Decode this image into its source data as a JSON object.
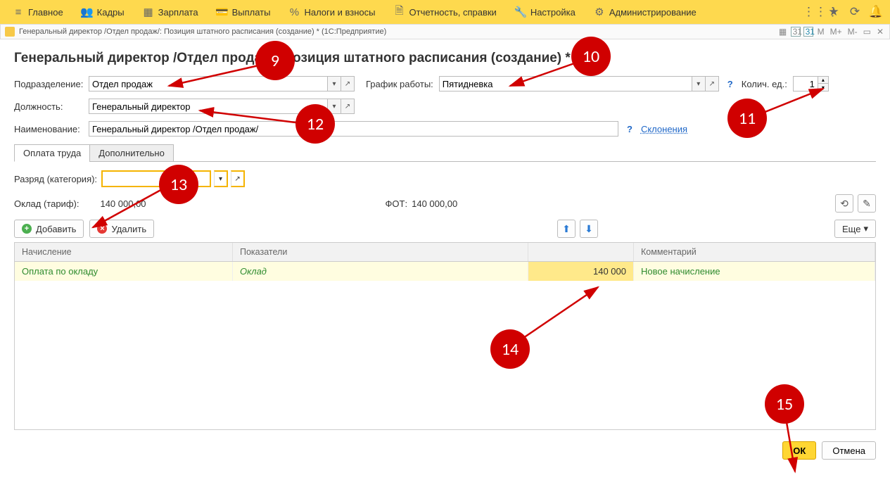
{
  "nav": {
    "items": [
      {
        "icon": "≡",
        "label": "Главное"
      },
      {
        "icon": "👥",
        "label": "Кадры"
      },
      {
        "icon": "▦",
        "label": "Зарплата"
      },
      {
        "icon": "💳",
        "label": "Выплаты"
      },
      {
        "icon": "%",
        "label": "Налоги и взносы"
      },
      {
        "icon": "🗎",
        "label": "Отчетность, справки"
      },
      {
        "icon": "🔧",
        "label": "Настройка"
      },
      {
        "icon": "⚙",
        "label": "Администрирование"
      }
    ],
    "right_glyphs": [
      "⋮⋮⋮",
      "★",
      "⟳",
      "🔔"
    ]
  },
  "windowbar": {
    "title": "Генеральный директор /Отдел продаж/: Позиция штатного расписания (создание) *  (1С:Предприятие)",
    "cal_text": "31",
    "m": "M",
    "mplus": "M+",
    "mminus": "M-",
    "dash": "▭",
    "close": "✕"
  },
  "page": {
    "title": "Генеральный директор /Отдел продаж/: Позиция штатного расписания (создание) *"
  },
  "labels": {
    "department": "Подразделение:",
    "position": "Должность:",
    "name": "Наименование:",
    "schedule": "График работы:",
    "qty": "Колич. ед.:",
    "declension": "Склонения",
    "rank": "Разряд (категория):",
    "salary": "Оклад (тариф):",
    "fot": "ФОТ:",
    "add": "Добавить",
    "del": "Удалить",
    "more": "Еще",
    "ok": "ОК",
    "cancel": "Отмена"
  },
  "values": {
    "department": "Отдел продаж",
    "position": "Генеральный директор",
    "name": "Генеральный директор /Отдел продаж/",
    "schedule": "Пятидневка",
    "qty": "1",
    "rank": "",
    "salary": "140 000,00",
    "fot": "140 000,00"
  },
  "tabs": {
    "pay": "Оплата труда",
    "extra": "Дополнительно"
  },
  "table": {
    "headers": {
      "accrual": "Начисление",
      "indicators": "Показатели",
      "amount": "",
      "comment": "Комментарий"
    },
    "rows": [
      {
        "accrual": "Оплата по окладу",
        "indicator": "Оклад",
        "amount": "140 000",
        "comment": "Новое начисление"
      }
    ]
  },
  "annotations": {
    "n9": "9",
    "n10": "10",
    "n11": "11",
    "n12": "12",
    "n13": "13",
    "n14": "14",
    "n15": "15"
  }
}
